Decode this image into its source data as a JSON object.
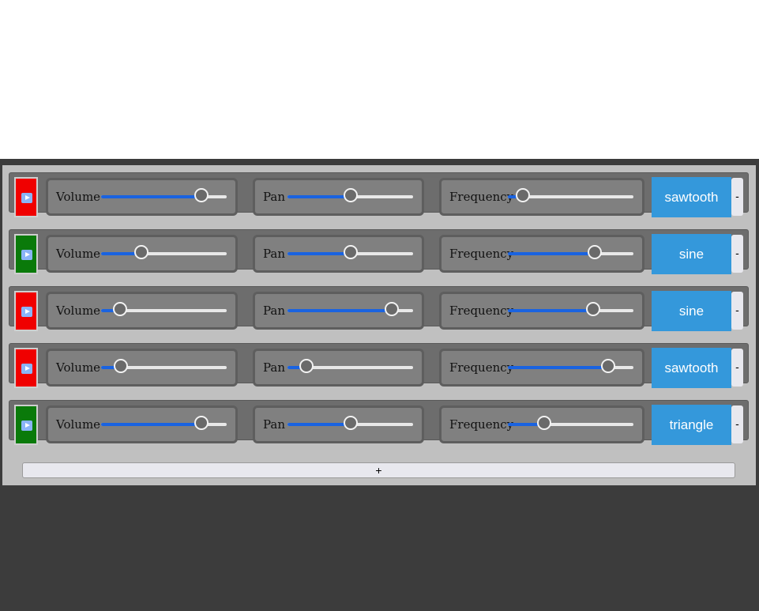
{
  "oscillators": [
    {
      "playing": false,
      "toggle_color": "#f00000",
      "volume_label": "Volume",
      "volume": 0.8,
      "pan_label": "Pan",
      "pan": 0.5,
      "frequency_label": "Frequency",
      "frequency": 0.12,
      "waveform": "sawtooth",
      "remove_label": "-"
    },
    {
      "playing": true,
      "toggle_color": "#0a7a0a",
      "volume_label": "Volume",
      "volume": 0.32,
      "pan_label": "Pan",
      "pan": 0.5,
      "frequency_label": "Frequency",
      "frequency": 0.69,
      "waveform": "sine",
      "remove_label": "-"
    },
    {
      "playing": false,
      "toggle_color": "#f00000",
      "volume_label": "Volume",
      "volume": 0.15,
      "pan_label": "Pan",
      "pan": 0.83,
      "frequency_label": "Frequency",
      "frequency": 0.68,
      "waveform": "sine",
      "remove_label": "-"
    },
    {
      "playing": false,
      "toggle_color": "#f00000",
      "volume_label": "Volume",
      "volume": 0.16,
      "pan_label": "Pan",
      "pan": 0.15,
      "frequency_label": "Frequency",
      "frequency": 0.8,
      "waveform": "sawtooth",
      "remove_label": "-"
    },
    {
      "playing": true,
      "toggle_color": "#0a7a0a",
      "volume_label": "Volume",
      "volume": 0.8,
      "pan_label": "Pan",
      "pan": 0.5,
      "frequency_label": "Frequency",
      "frequency": 0.29,
      "waveform": "triangle",
      "remove_label": "-"
    }
  ],
  "add_button": {
    "label": "+"
  },
  "colors": {
    "accent": "#3498db",
    "slider_fill": "#1a63e0",
    "playing": "#0a7a0a",
    "stopped": "#f00000"
  },
  "icons": {
    "toggle": "play-icon"
  }
}
